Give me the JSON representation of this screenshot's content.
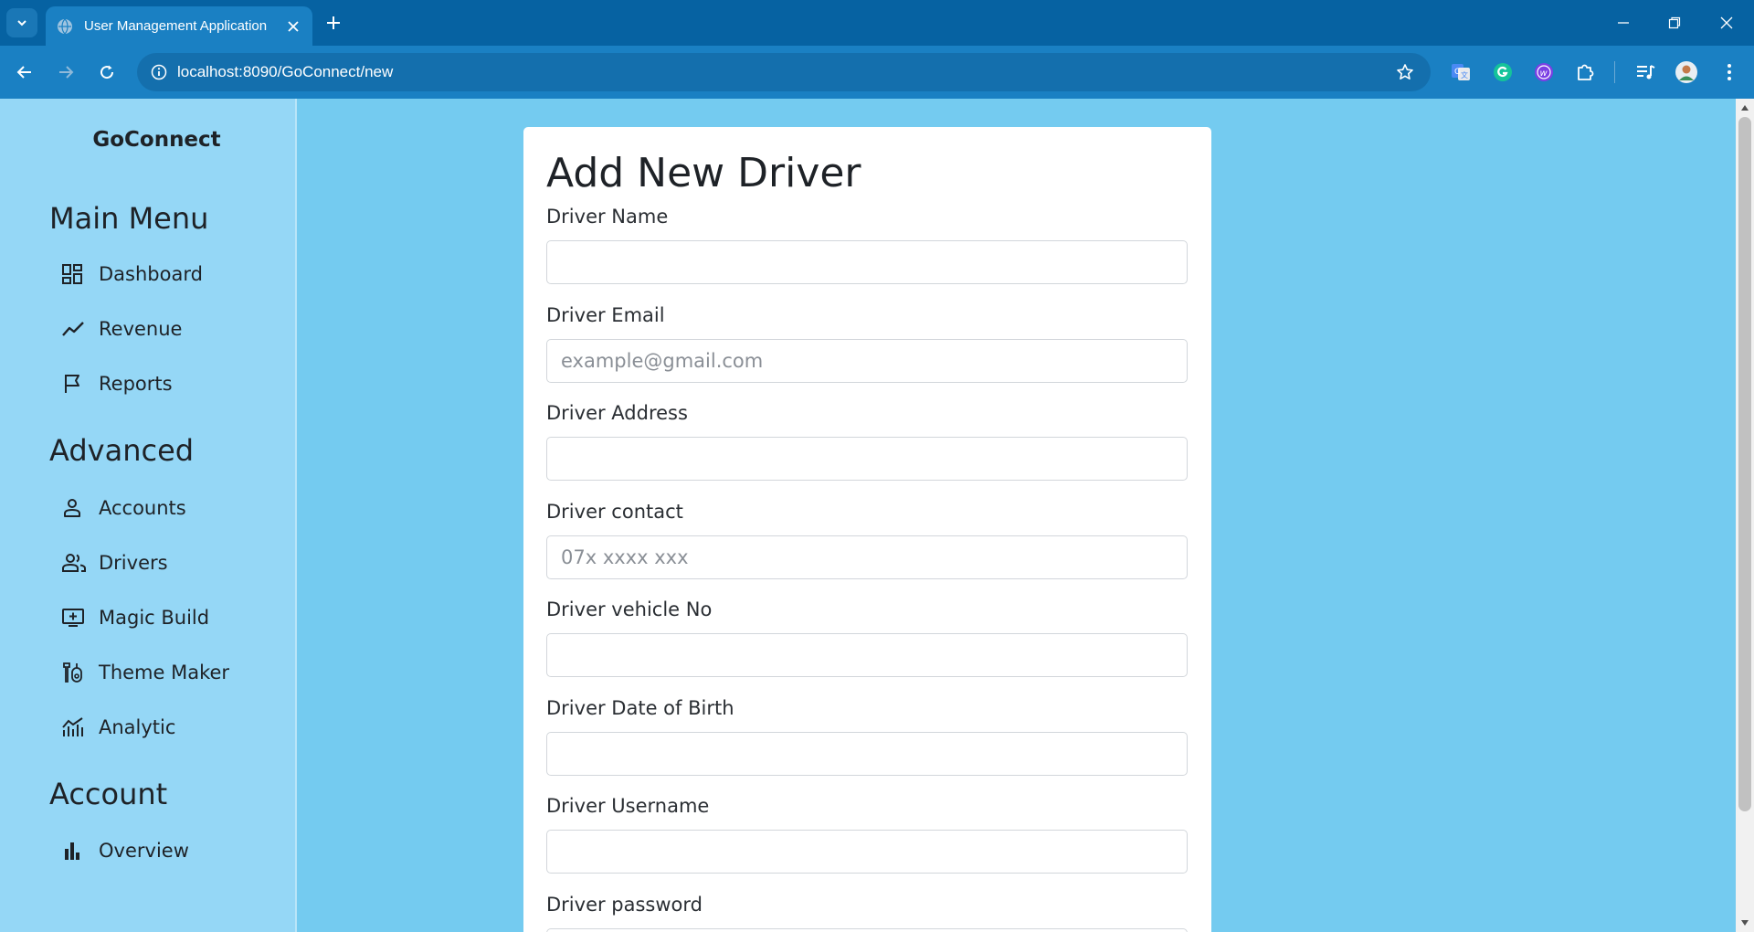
{
  "browser": {
    "tab_title": "User Management Application",
    "url": "localhost:8090/GoConnect/new"
  },
  "sidebar": {
    "brand": "GoConnect",
    "main_menu_title": "Main Menu",
    "main_menu": [
      {
        "label": "Dashboard",
        "icon": "dashboard-icon"
      },
      {
        "label": "Revenue",
        "icon": "trending-line-icon"
      },
      {
        "label": "Reports",
        "icon": "flag-icon"
      }
    ],
    "advanced_title": "Advanced",
    "advanced": [
      {
        "label": "Accounts",
        "icon": "person-icon"
      },
      {
        "label": "Drivers",
        "icon": "people-icon"
      },
      {
        "label": "Magic Build",
        "icon": "add-to-queue-icon"
      },
      {
        "label": "Theme Maker",
        "icon": "theme-icon"
      },
      {
        "label": "Analytic",
        "icon": "analytics-icon"
      }
    ],
    "account_title": "Account",
    "account": [
      {
        "label": "Overview",
        "icon": "bar-chart-icon"
      }
    ]
  },
  "form": {
    "title": "Add New Driver",
    "fields": [
      {
        "label": "Driver Name",
        "placeholder": "",
        "value": ""
      },
      {
        "label": "Driver Email",
        "placeholder": "example@gmail.com",
        "value": ""
      },
      {
        "label": "Driver Address",
        "placeholder": "",
        "value": ""
      },
      {
        "label": "Driver contact",
        "placeholder": "07x xxxx xxx",
        "value": ""
      },
      {
        "label": "Driver vehicle No",
        "placeholder": "",
        "value": ""
      },
      {
        "label": "Driver Date of Birth",
        "placeholder": "",
        "value": ""
      },
      {
        "label": "Driver Username",
        "placeholder": "",
        "value": ""
      },
      {
        "label": "Driver password",
        "placeholder": "",
        "value": ""
      }
    ]
  },
  "colors": {
    "chrome_dark": "#0662a2",
    "chrome_toolbar": "#1a80c3",
    "page_background": "#74cbf0",
    "sidebar_background": "#95d7f6",
    "card_background": "#ffffff"
  }
}
